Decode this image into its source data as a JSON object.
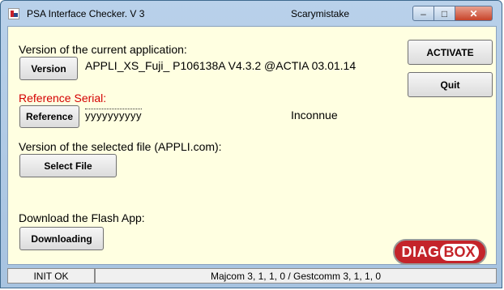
{
  "window": {
    "title": "PSA Interface Checker. V 3",
    "subtitle": "Scarymistake",
    "controls": {
      "minimize": "–",
      "maximize": "□",
      "close": "✕"
    }
  },
  "version_section": {
    "label": "Version of the current application:",
    "button": "Version",
    "value": "APPLI_XS_Fuji_ P106138A  V4.3.2 @ACTIA 03.01.14"
  },
  "reference_section": {
    "label": "Reference Serial:",
    "button": "Reference",
    "serial": "yyyyyyyyyy",
    "status": "Inconnue"
  },
  "file_section": {
    "label": "Version of the selected file (APPLI.com):",
    "button": "Select File"
  },
  "download_section": {
    "label": "Download the Flash App:",
    "button": "Downloading"
  },
  "side_buttons": {
    "activate": "ACTIVATE",
    "quit": "Quit"
  },
  "logo": {
    "part1": "DIAG",
    "part2": "BOX"
  },
  "statusbar": {
    "left": "INIT OK",
    "right": "Majcom 3, 1, 1, 0 / Gestcomm 3, 1, 1, 0"
  },
  "colors": {
    "accent_red": "#d40000",
    "client_bg": "#ffffe1",
    "logo_red": "#c4242a"
  }
}
